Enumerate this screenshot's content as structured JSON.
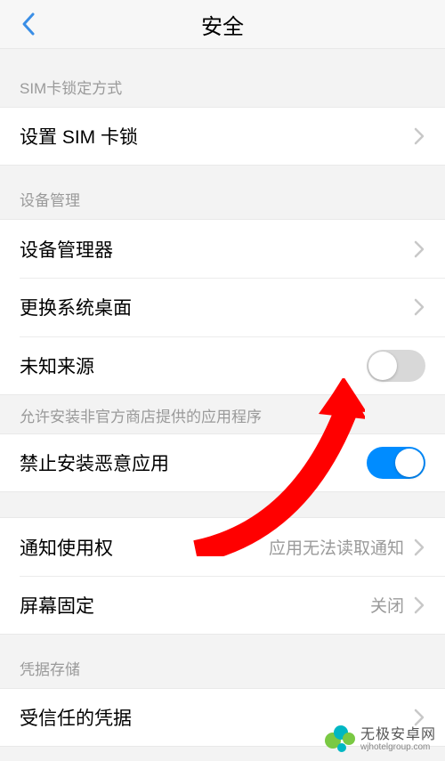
{
  "header": {
    "title": "安全"
  },
  "sections": {
    "sim": {
      "header": "SIM卡锁定方式",
      "item": "设置 SIM 卡锁"
    },
    "device": {
      "header": "设备管理",
      "manager": "设备管理器",
      "launcher": "更换系统桌面",
      "unknown": "未知来源",
      "unknown_on": false,
      "footer": "允许安装非官方商店提供的应用程序",
      "block_malicious": "禁止安装恶意应用",
      "block_malicious_on": true
    },
    "notif": {
      "access": "通知使用权",
      "access_value": "应用无法读取通知",
      "pin": "屏幕固定",
      "pin_value": "关闭"
    },
    "cred": {
      "header": "凭据存储",
      "trusted": "受信任的凭据"
    }
  },
  "watermark": {
    "brand": "无极安卓网",
    "url": "wjhotelgroup.com"
  },
  "colors": {
    "accent": "#008cff",
    "arrow": "#ff0000",
    "chevron": "#c8c8c8",
    "back": "#3a8ee6"
  }
}
